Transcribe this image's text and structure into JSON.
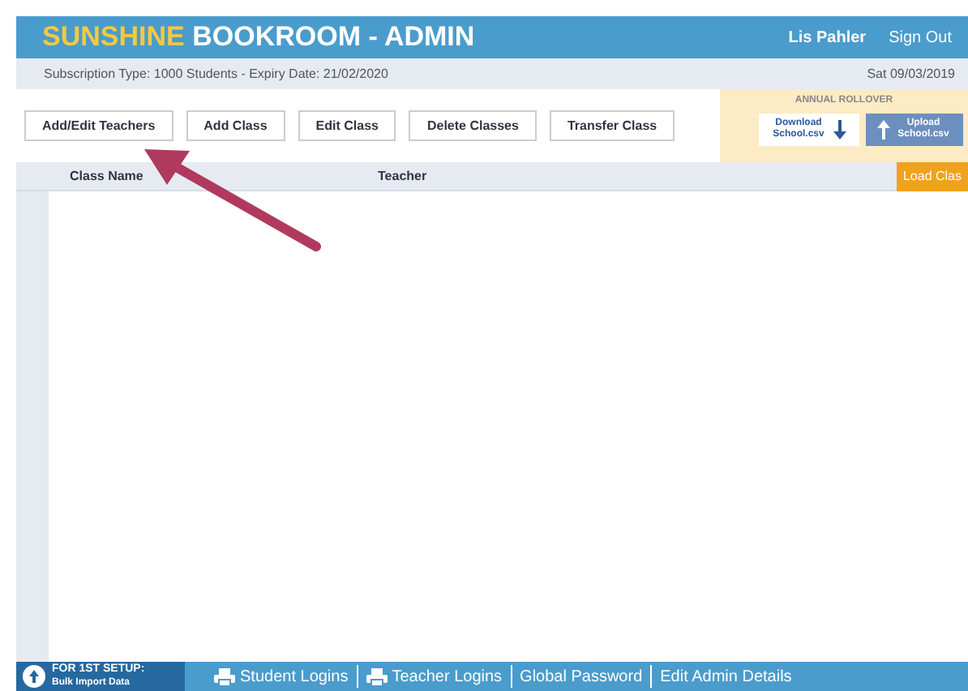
{
  "header": {
    "title_highlight": "SUNSHINE",
    "title_rest": "BOOKROOM - ADMIN",
    "user": "Lis Pahler",
    "sign_out": "Sign Out"
  },
  "info_bar": {
    "subscription": "Subscription Type: 1000 Students - Expiry Date: 21/02/2020",
    "date": "Sat 09/03/2019"
  },
  "toolbar": [
    "Add/Edit Teachers",
    "Add Class",
    "Edit Class",
    "Delete Classes",
    "Transfer Class"
  ],
  "rollover": {
    "title": "ANNUAL ROLLOVER",
    "download": "Download School.csv",
    "upload": "Upload School.csv"
  },
  "table": {
    "columns": [
      "Class Name",
      "Teacher"
    ],
    "load_button": "Load Clas"
  },
  "footer": {
    "setup_title": "FOR 1ST SETUP:",
    "setup_sub": "Bulk Import Data",
    "links": [
      {
        "label": "Student Logins",
        "kind": "print"
      },
      {
        "label": "Teacher Logins",
        "kind": "print"
      },
      {
        "label": "Global Password",
        "kind": "plain"
      },
      {
        "label": "Edit Admin Details",
        "kind": "plain"
      }
    ]
  }
}
